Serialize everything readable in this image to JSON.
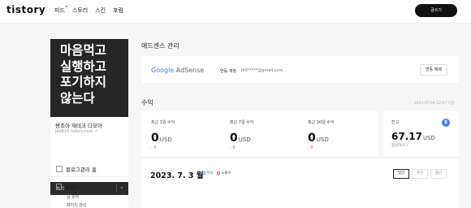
{
  "header": {
    "logo": "tistory",
    "nav": [
      "피드",
      "스토리",
      "스킨",
      "포럼"
    ],
    "write_button": "글쓰기"
  },
  "sidebar": {
    "cover_lines": [
      "마음먹고",
      "실행하고",
      "포기하지",
      "않는다"
    ],
    "blog_name": "짱조아 재테크 다모아",
    "blog_url": "ja0824.tistory.com",
    "write_label": "쓰기",
    "menu": {
      "home": "블로그관리 홈",
      "content": "콘텐츠",
      "content_sub": [
        "글 관리",
        "페이지 관리"
      ]
    }
  },
  "adsense": {
    "section_title": "애드센스 관리",
    "logo_google": "Google",
    "logo_adsense": "AdSense",
    "account_label": "연동 계정",
    "account_email": "j40*****@gmail.com",
    "unlink_button": "연동 해제"
  },
  "revenue": {
    "section_title": "수익",
    "updated": "2023.07.04 12:07 기준",
    "stats": [
      {
        "label": "최근 1일 수익",
        "value": "0",
        "unit": "USD",
        "change": "- 0"
      },
      {
        "label": "최근 7일 수익",
        "value": "0",
        "unit": "USD",
        "change": "- 0"
      },
      {
        "label": "최근 30일 수익",
        "value": "0",
        "unit": "USD",
        "change": "- 0"
      }
    ],
    "balance": {
      "label": "잔고",
      "value": "67.17",
      "unit": "USD",
      "settle": "정산하기 〉",
      "badge": "$"
    }
  },
  "chart_panel": {
    "date": "2023. 7. 3 월",
    "legend": [
      "수익",
      "노출수"
    ],
    "tabs": [
      "일간",
      "주간",
      "월간"
    ],
    "active_tab": "일간"
  },
  "colors": {
    "accent_blue": "#3b82f6",
    "negative_red": "#ef4444",
    "dark": "#111111"
  }
}
